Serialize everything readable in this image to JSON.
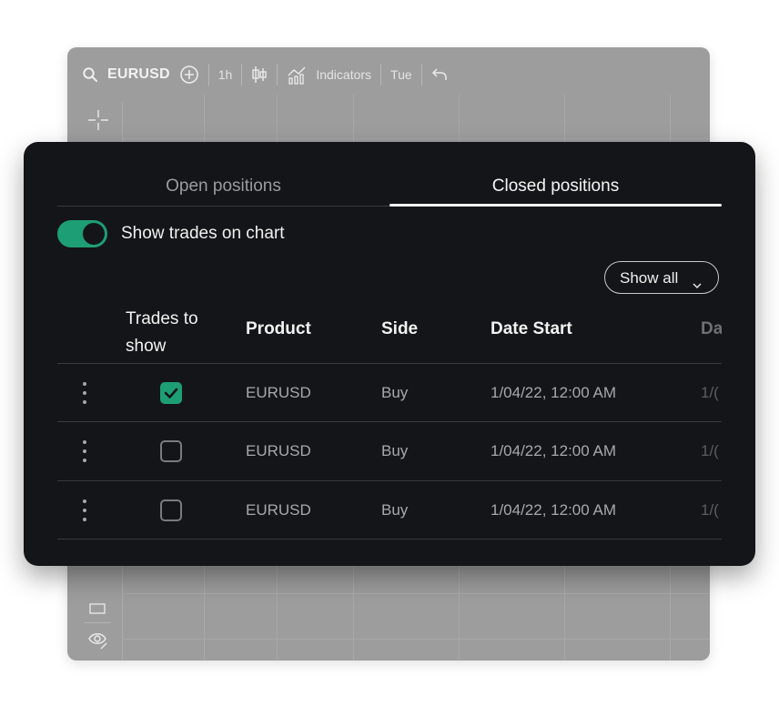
{
  "toolbar": {
    "symbol": "EURUSD",
    "interval": "1h",
    "indicators_label": "Indicators",
    "day_label": "Tue"
  },
  "tabs": [
    {
      "label": "Open positions",
      "active": false
    },
    {
      "label": "Closed positions",
      "active": true
    }
  ],
  "show_trades": {
    "label": "Show trades on chart",
    "enabled": true
  },
  "filter": {
    "label": "Show all"
  },
  "table": {
    "columns": [
      "Trades to show",
      "Product",
      "Side",
      "Date Start",
      "Da"
    ],
    "rows": [
      {
        "checked": true,
        "product": "EURUSD",
        "side": "Buy",
        "date_start": "1/04/22, 12:00 AM",
        "date_end": "1/("
      },
      {
        "checked": false,
        "product": "EURUSD",
        "side": "Buy",
        "date_start": "1/04/22, 12:00 AM",
        "date_end": "1/("
      },
      {
        "checked": false,
        "product": "EURUSD",
        "side": "Buy",
        "date_start": "1/04/22, 12:00 AM",
        "date_end": "1/("
      }
    ]
  },
  "colors": {
    "accent": "#1e9e74",
    "panel_bg": "#141518",
    "chart_bg": "#9d9d9d"
  }
}
